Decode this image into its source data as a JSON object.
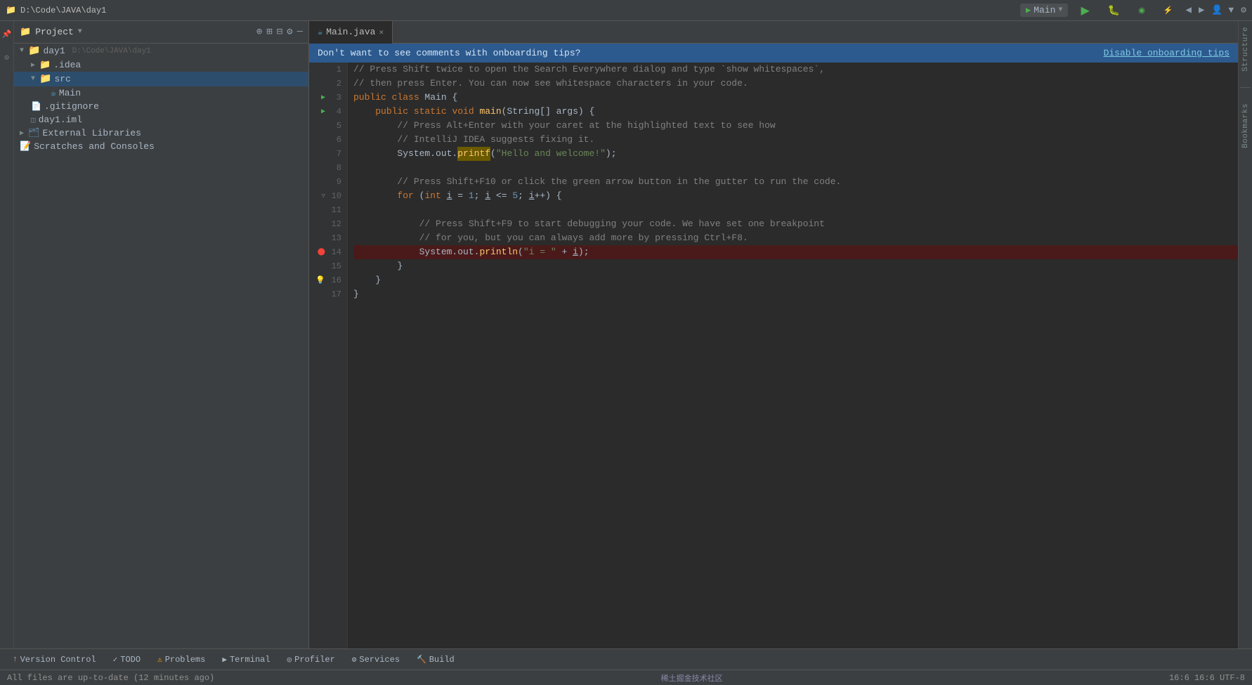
{
  "titlebar": {
    "project_icon": "📁",
    "project_name": "day1",
    "path": "D:\\Code\\JAVA\\day1",
    "run_config": "Main",
    "run_icon": "▶",
    "debug_icon": "🐛",
    "coverage_icon": "◉",
    "profile_icon": "⚡"
  },
  "project_panel": {
    "title": "Project",
    "expand_all_icon": "⊞",
    "collapse_icon": "⊟",
    "settings_icon": "⚙",
    "close_icon": "—",
    "tree": [
      {
        "id": "day1",
        "label": "day1",
        "path": "D:\\Code\\JAVA\\day1",
        "type": "root",
        "indent": 0,
        "expanded": true
      },
      {
        "id": "idea",
        "label": ".idea",
        "type": "folder",
        "indent": 1,
        "expanded": false
      },
      {
        "id": "src",
        "label": "src",
        "type": "src-folder",
        "indent": 1,
        "expanded": true
      },
      {
        "id": "main",
        "label": "Main",
        "type": "java",
        "indent": 2
      },
      {
        "id": "gitignore",
        "label": ".gitignore",
        "type": "file",
        "indent": 1
      },
      {
        "id": "day1iml",
        "label": "day1.iml",
        "type": "file",
        "indent": 1
      },
      {
        "id": "ext-libs",
        "label": "External Libraries",
        "type": "libs",
        "indent": 0,
        "expanded": false
      },
      {
        "id": "scratches",
        "label": "Scratches and Consoles",
        "type": "scratches",
        "indent": 0
      }
    ]
  },
  "editor": {
    "tab": {
      "icon": "☕",
      "filename": "Main.java",
      "close_icon": "✕"
    },
    "onboarding_banner": {
      "text": "Don't want to see comments with onboarding tips?",
      "action_label": "Disable onboarding tips"
    },
    "lines": [
      {
        "num": 1,
        "content": "// Press Shift twice to open the Search Everywhere dialog and type `show whitespaces`,",
        "type": "comment"
      },
      {
        "num": 2,
        "content": "// then press Enter. You can now see whitespace characters in your code.",
        "type": "comment"
      },
      {
        "num": 3,
        "content": "public class Main {",
        "type": "code",
        "has_arrow": true,
        "fold": true
      },
      {
        "num": 4,
        "content": "    public static void main(String[] args) {",
        "type": "code",
        "has_arrow": true,
        "fold": true
      },
      {
        "num": 5,
        "content": "        // Press Alt+Enter with your caret at the highlighted text to see how",
        "type": "comment"
      },
      {
        "num": 6,
        "content": "        // IntelliJ IDEA suggests fixing it.",
        "type": "comment"
      },
      {
        "num": 7,
        "content": "        System.out.printf(\"Hello and welcome!\");",
        "type": "code",
        "highlight_word": "printf"
      },
      {
        "num": 8,
        "content": "",
        "type": "empty"
      },
      {
        "num": 9,
        "content": "        // Press Shift+F10 or click the green arrow button in the gutter to run the code.",
        "type": "comment"
      },
      {
        "num": 10,
        "content": "        for (int i = 1; i <= 5; i++) {",
        "type": "code",
        "fold": true
      },
      {
        "num": 11,
        "content": "",
        "type": "empty"
      },
      {
        "num": 12,
        "content": "            // Press Shift+F9 to start debugging your code. We have set one breakpoint",
        "type": "comment"
      },
      {
        "num": 13,
        "content": "            // for you, but you can always add more by pressing Ctrl+F8.",
        "type": "comment"
      },
      {
        "num": 14,
        "content": "            System.out.println(\"i = \" + i);",
        "type": "code",
        "breakpoint": true,
        "highlighted": true
      },
      {
        "num": 15,
        "content": "        }",
        "type": "code"
      },
      {
        "num": 16,
        "content": "    }",
        "type": "code",
        "lightbulb": true
      },
      {
        "num": 17,
        "content": "}",
        "type": "code"
      }
    ]
  },
  "bottom_tabs": [
    {
      "id": "version-control",
      "icon": "↑",
      "label": "Version Control"
    },
    {
      "id": "todo",
      "icon": "✓",
      "label": "TODO"
    },
    {
      "id": "problems",
      "icon": "⚠",
      "label": "Problems"
    },
    {
      "id": "terminal",
      "icon": "▶",
      "label": "Terminal"
    },
    {
      "id": "profiler",
      "icon": "◎",
      "label": "Profiler"
    },
    {
      "id": "services",
      "icon": "⚙",
      "label": "Services"
    },
    {
      "id": "build",
      "icon": "🔨",
      "label": "Build"
    }
  ],
  "status_bar": {
    "left_text": "All files are up-to-date (12 minutes ago)",
    "right_text": "16:6  16:6 UTF-8",
    "attribution": "稀土掘金技术社区"
  },
  "right_panel": {
    "structure_label": "Structure",
    "bookmarks_label": "Bookmarks"
  }
}
